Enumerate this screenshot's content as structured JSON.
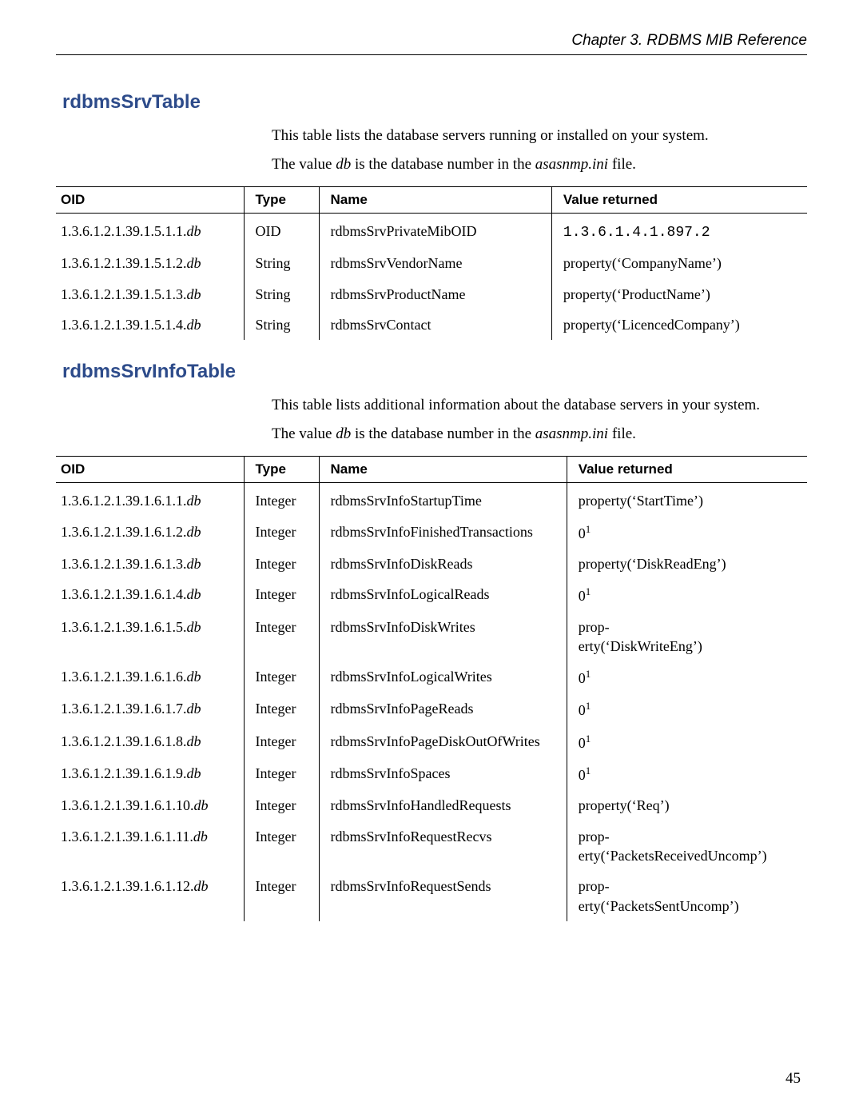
{
  "header": {
    "chapter": "Chapter 3.  RDBMS MIB Reference"
  },
  "section1": {
    "title": "rdbmsSrvTable",
    "intro_line1": "This table lists the database servers running or installed on your system.",
    "intro_line2_a": "The value ",
    "intro_line2_db": "db",
    "intro_line2_b": " is the database number in the ",
    "intro_line2_file": "asasnmp.ini",
    "intro_line2_c": " file.",
    "columns": {
      "c1": "OID",
      "c2": "Type",
      "c3": "Name",
      "c4": "Value returned"
    },
    "rows": [
      {
        "oid_pre": "1.3.6.1.2.1.39.1.5.1.1.",
        "oid_suf": "db",
        "type": "OID",
        "name": "rdbmsSrvPrivateMibOID",
        "val": "1.3.6.1.4.1.897.2",
        "val_mono": true
      },
      {
        "oid_pre": "1.3.6.1.2.1.39.1.5.1.2.",
        "oid_suf": "db",
        "type": "String",
        "name": "rdbmsSrvVendorName",
        "val": "property(‘CompanyName’)"
      },
      {
        "oid_pre": "1.3.6.1.2.1.39.1.5.1.3.",
        "oid_suf": "db",
        "type": "String",
        "name": "rdbmsSrvProductName",
        "val": "property(‘ProductName’)"
      },
      {
        "oid_pre": "1.3.6.1.2.1.39.1.5.1.4.",
        "oid_suf": "db",
        "type": "String",
        "name": "rdbmsSrvContact",
        "val": "property(‘LicencedCompany’)"
      }
    ]
  },
  "section2": {
    "title": "rdbmsSrvInfoTable",
    "intro_line1": "This table lists additional information about the database servers in your system.",
    "intro_line2_a": "The value ",
    "intro_line2_db": "db",
    "intro_line2_b": " is the database number in the ",
    "intro_line2_file": "asasnmp.ini",
    "intro_line2_c": " file.",
    "columns": {
      "c1": "OID",
      "c2": "Type",
      "c3": "Name",
      "c4": "Value returned"
    },
    "rows": [
      {
        "oid_pre": "1.3.6.1.2.1.39.1.6.1.1.",
        "oid_suf": "db",
        "type": "Integer",
        "name": "rdbmsSrvInfoStartupTime",
        "val": "property(‘StartTime’)"
      },
      {
        "oid_pre": "1.3.6.1.2.1.39.1.6.1.2.",
        "oid_suf": "db",
        "type": "Integer",
        "name": "rdbmsSrvInfoFinishedTransactions",
        "val": "0",
        "sup": "1"
      },
      {
        "oid_pre": "1.3.6.1.2.1.39.1.6.1.3.",
        "oid_suf": "db",
        "type": "Integer",
        "name": "rdbmsSrvInfoDiskReads",
        "val": "property(‘DiskReadEng’)"
      },
      {
        "oid_pre": "1.3.6.1.2.1.39.1.6.1.4.",
        "oid_suf": "db",
        "type": "Integer",
        "name": "rdbmsSrvInfoLogicalReads",
        "val": "0",
        "sup": "1"
      },
      {
        "oid_pre": "1.3.6.1.2.1.39.1.6.1.5.",
        "oid_suf": "db",
        "type": "Integer",
        "name": "rdbmsSrvInfoDiskWrites",
        "val": "prop-\nerty(‘DiskWriteEng’)"
      },
      {
        "oid_pre": "1.3.6.1.2.1.39.1.6.1.6.",
        "oid_suf": "db",
        "type": "Integer",
        "name": "rdbmsSrvInfoLogicalWrites",
        "val": "0",
        "sup": "1"
      },
      {
        "oid_pre": "1.3.6.1.2.1.39.1.6.1.7.",
        "oid_suf": "db",
        "type": "Integer",
        "name": "rdbmsSrvInfoPageReads",
        "val": "0",
        "sup": "1"
      },
      {
        "oid_pre": "1.3.6.1.2.1.39.1.6.1.8.",
        "oid_suf": "db",
        "type": "Integer",
        "name": "rdbmsSrvInfoPageDiskOutOfWrites",
        "val": "0",
        "sup": "1"
      },
      {
        "oid_pre": "1.3.6.1.2.1.39.1.6.1.9.",
        "oid_suf": "db",
        "type": "Integer",
        "name": "rdbmsSrvInfoSpaces",
        "val": "0",
        "sup": "1"
      },
      {
        "oid_pre": "1.3.6.1.2.1.39.1.6.1.10.",
        "oid_suf": "db",
        "type": "Integer",
        "name": "rdbmsSrvInfoHandledRequests",
        "val": "property(‘Req’)"
      },
      {
        "oid_pre": "1.3.6.1.2.1.39.1.6.1.11.",
        "oid_suf": "db",
        "type": "Integer",
        "name": "rdbmsSrvInfoRequestRecvs",
        "val": "prop-\nerty(‘PacketsReceivedUncomp’)"
      },
      {
        "oid_pre": "1.3.6.1.2.1.39.1.6.1.12.",
        "oid_suf": "db",
        "type": "Integer",
        "name": "rdbmsSrvInfoRequestSends",
        "val": "prop-\nerty(‘PacketsSentUncomp’)"
      }
    ]
  },
  "page_number": "45"
}
